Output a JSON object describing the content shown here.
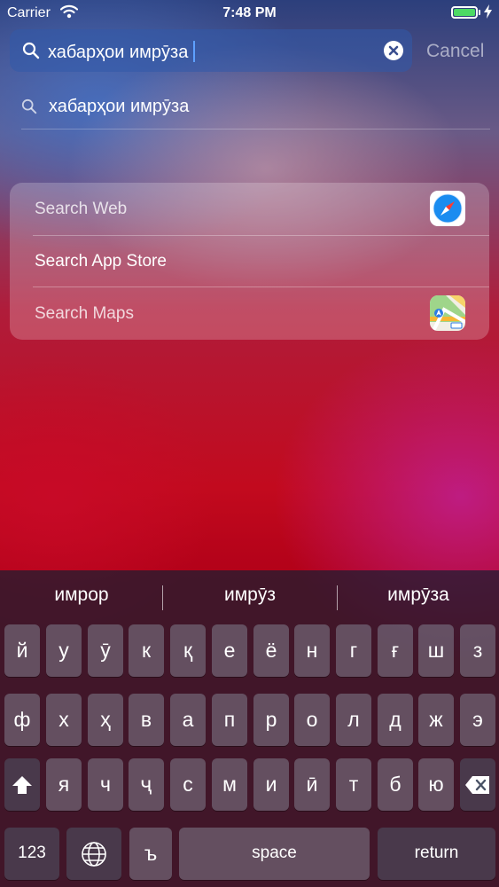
{
  "status_bar": {
    "carrier": "Carrier",
    "time": "7:48 PM"
  },
  "search": {
    "query": "хабарҳои имрӯза",
    "cancel_label": "Cancel"
  },
  "suggestion": {
    "text": "хабарҳои имрӯза"
  },
  "card": {
    "items": [
      {
        "label": "Search Web",
        "icon": "safari-icon"
      },
      {
        "label": "Search App Store",
        "icon": ""
      },
      {
        "label": "Search Maps",
        "icon": "maps-icon"
      }
    ]
  },
  "keyboard": {
    "predictions": [
      "имрор",
      "имрӯз",
      "имрӯза"
    ],
    "rows": [
      [
        "й",
        "у",
        "ӯ",
        "к",
        "қ",
        "е",
        "ё",
        "н",
        "г",
        "ғ",
        "ш",
        "з"
      ],
      [
        "ф",
        "х",
        "ҳ",
        "в",
        "а",
        "п",
        "р",
        "о",
        "л",
        "д",
        "ж",
        "э"
      ],
      [
        "я",
        "ч",
        "ҷ",
        "с",
        "м",
        "и",
        "ӣ",
        "т",
        "б",
        "ю"
      ]
    ],
    "numbers_label": "123",
    "hard_sign": "ъ",
    "space_label": "space",
    "return_label": "return"
  },
  "colors": {
    "caret": "#5ea0ff",
    "battery": "#4cd964"
  }
}
